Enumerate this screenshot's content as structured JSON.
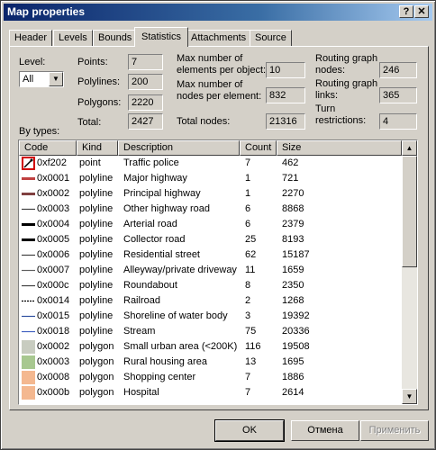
{
  "window": {
    "title": "Map properties",
    "help_label": "?",
    "close_label": "✕"
  },
  "tabs": [
    "Header",
    "Levels",
    "Bounds",
    "Statistics",
    "Attachments",
    "Source"
  ],
  "active_tab": "Statistics",
  "level": {
    "label": "Level:",
    "value": "All"
  },
  "stats": {
    "points_label": "Points:",
    "points": "7",
    "polylines_label": "Polylines:",
    "polylines": "200",
    "polygons_label": "Polygons:",
    "polygons": "2220",
    "total_label": "Total:",
    "total": "2427",
    "max_elements_label_1": "Max number of",
    "max_elements_label_2": "elements per object:",
    "max_elements": "10",
    "max_nodes_label_1": "Max number of",
    "max_nodes_label_2": "nodes per element:",
    "max_nodes": "832",
    "total_nodes_label": "Total nodes:",
    "total_nodes": "21316",
    "routing_nodes_label_1": "Routing graph",
    "routing_nodes_label_2": "nodes:",
    "routing_nodes": "246",
    "routing_links_label_1": "Routing graph",
    "routing_links_label_2": "links:",
    "routing_links": "365",
    "turn_label_1": "Turn",
    "turn_label_2": "restrictions:",
    "turn": "4"
  },
  "by_types_label": "By types:",
  "columns": [
    "Code",
    "Kind",
    "Description",
    "Count",
    "Size"
  ],
  "rows": [
    {
      "code": "0xf202",
      "kind": "point",
      "desc": "Traffic police",
      "count": "7",
      "size": "462",
      "swatch": "police-icon"
    },
    {
      "code": "0x0001",
      "kind": "polyline",
      "desc": "Major highway",
      "count": "1",
      "size": "721",
      "swatch": "line-major-highway",
      "color": "#c04040"
    },
    {
      "code": "0x0002",
      "kind": "polyline",
      "desc": "Principal highway",
      "count": "1",
      "size": "2270",
      "swatch": "line-principal-highway",
      "color": "#804040"
    },
    {
      "code": "0x0003",
      "kind": "polyline",
      "desc": "Other highway road",
      "count": "6",
      "size": "8868",
      "swatch": "line-other-highway",
      "color": "#404040"
    },
    {
      "code": "0x0004",
      "kind": "polyline",
      "desc": "Arterial road",
      "count": "6",
      "size": "2379",
      "swatch": "line-arterial",
      "color": "#000000"
    },
    {
      "code": "0x0005",
      "kind": "polyline",
      "desc": "Collector road",
      "count": "25",
      "size": "8193",
      "swatch": "line-collector",
      "color": "#000000"
    },
    {
      "code": "0x0006",
      "kind": "polyline",
      "desc": "Residential street",
      "count": "62",
      "size": "15187",
      "swatch": "line-residential",
      "color": "#404040"
    },
    {
      "code": "0x0007",
      "kind": "polyline",
      "desc": "Alleyway/private driveway",
      "count": "11",
      "size": "1659",
      "swatch": "line-alleyway",
      "color": "#606060"
    },
    {
      "code": "0x000c",
      "kind": "polyline",
      "desc": "Roundabout",
      "count": "8",
      "size": "2350",
      "swatch": "line-roundabout",
      "color": "#404040"
    },
    {
      "code": "0x0014",
      "kind": "polyline",
      "desc": "Railroad",
      "count": "2",
      "size": "1268",
      "swatch": "line-railroad",
      "color": "#000000"
    },
    {
      "code": "0x0015",
      "kind": "polyline",
      "desc": "Shoreline of water body",
      "count": "3",
      "size": "19392",
      "swatch": "line-shoreline",
      "color": "#3050a0"
    },
    {
      "code": "0x0018",
      "kind": "polyline",
      "desc": "Stream",
      "count": "75",
      "size": "20336",
      "swatch": "line-stream",
      "color": "#4060c0"
    },
    {
      "code": "0x0002",
      "kind": "polygon",
      "desc": "Small urban area (<200K)",
      "count": "116",
      "size": "19508",
      "swatch": "fill-urban",
      "color": "#c8ccc0"
    },
    {
      "code": "0x0003",
      "kind": "polygon",
      "desc": "Rural housing area",
      "count": "13",
      "size": "1695",
      "swatch": "fill-rural",
      "color": "#a8c890"
    },
    {
      "code": "0x0008",
      "kind": "polygon",
      "desc": "Shopping center",
      "count": "7",
      "size": "1886",
      "swatch": "fill-shopping",
      "color": "#f4b890"
    },
    {
      "code": "0x000b",
      "kind": "polygon",
      "desc": "Hospital",
      "count": "7",
      "size": "2614",
      "swatch": "fill-hospital",
      "color": "#f4b890"
    }
  ],
  "buttons": {
    "ok": "OK",
    "cancel": "Отмена",
    "apply": "Применить"
  }
}
